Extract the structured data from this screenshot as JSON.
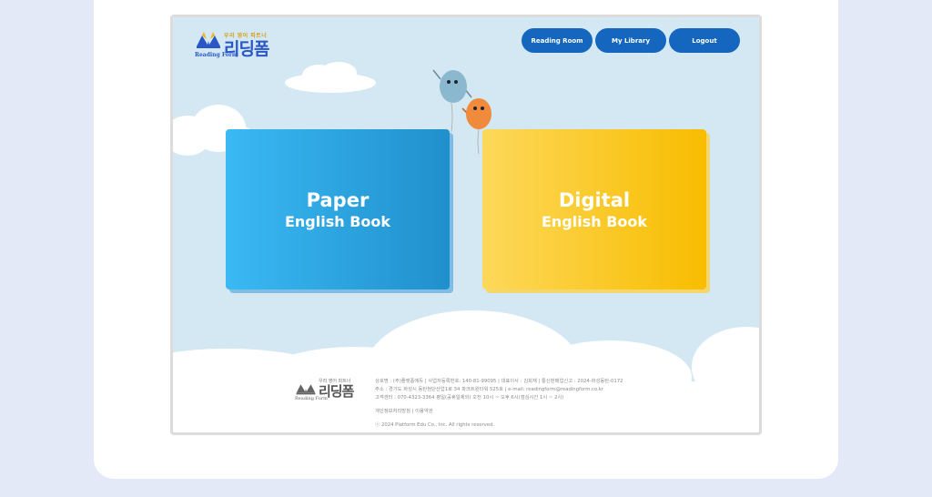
{
  "logo": {
    "tagline": "우리 영어 파트너",
    "brand": "리딩폼",
    "sub": "Reading Form"
  },
  "nav": {
    "reading_room": "Reading Room",
    "my_library": "My Library",
    "logout": "Logout"
  },
  "cards": {
    "paper": {
      "line1": "Paper",
      "line2": "English Book"
    },
    "digital": {
      "line1": "Digital",
      "line2": "English Book"
    }
  },
  "footer": {
    "logo_tagline": "우리 영어 파트너",
    "logo_brand": "리딩폼",
    "logo_sub": "Reading Form",
    "line1": "상호명 : (주)플랫폼에듀 | 사업자등록번호: 140-81-99095 | 대표이사 : 김희재 | 통신판매업신고 : 2024-화성동탄-0172",
    "line2": "주소 : 경기도 화성시 동탄첨단산업1로 34 파크트윈타워 525호 | e-mail: readingform@readingform.co.kr",
    "line3": "고객센터 : 070-4323-3364 평일(공휴일제외) 오전 10시 ~ 오후 6시(점심시간 1시 ~ 2시)",
    "links": "개인정보처리방침  |  이용약관",
    "copyright": "ⓒ 2024 Platform Edu Co., Inc. All rights reserved."
  },
  "colors": {
    "page_bg": "#e3e9f7",
    "sky": "#d4e8f4",
    "nav_button": "#1566be",
    "paper_card": "#2aa6e6",
    "digital_card": "#fcca2a",
    "balloon_blue": "#8ab8cf",
    "balloon_orange": "#f08a3c"
  }
}
